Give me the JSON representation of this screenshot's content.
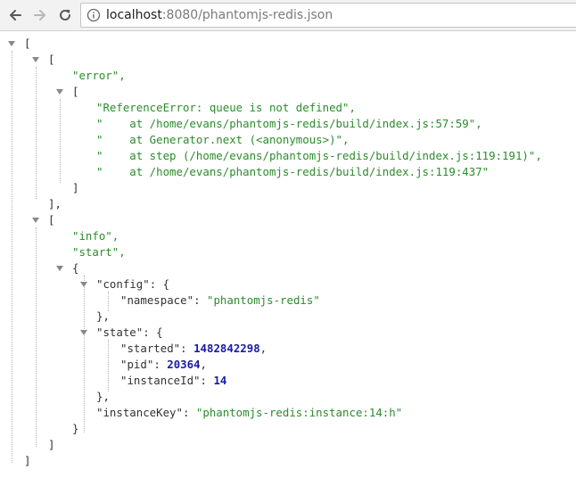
{
  "browser": {
    "url_host": "localhost",
    "url_path": ":8080/phantomjs-redis.json",
    "back_icon": "arrow-left-icon",
    "forward_icon": "arrow-right-icon",
    "reload_icon": "reload-icon",
    "info_icon": "info-circle-icon"
  },
  "json": {
    "open_bracket": "[",
    "close_bracket": "]",
    "close_bracket_comma": "],",
    "open_brace": "{",
    "close_brace": "}",
    "close_brace_comma": "},",
    "entry1": {
      "level": "\"error\",",
      "stack": [
        "\"ReferenceError: queue is not defined\",",
        "\"    at /home/evans/phantomjs-redis/build/index.js:57:59\",",
        "\"    at Generator.next (<anonymous>)\",",
        "\"    at step (/home/evans/phantomjs-redis/build/index.js:119:191)\",",
        "\"    at /home/evans/phantomjs-redis/build/index.js:119:437\""
      ]
    },
    "entry2": {
      "level": "\"info\",",
      "event": "\"start\",",
      "config_key": "\"config\"",
      "namespace_key": "\"namespace\"",
      "namespace_value": "\"phantomjs-redis\"",
      "state_key": "\"state\"",
      "started_key": "\"started\"",
      "started_value": "1482842298",
      "pid_key": "\"pid\"",
      "pid_value": "20364",
      "instanceId_key": "\"instanceId\"",
      "instanceId_value": "14",
      "instanceKey_key": "\"instanceKey\"",
      "instanceKey_value": "\"phantomjs-redis:instance:14:h\""
    }
  }
}
